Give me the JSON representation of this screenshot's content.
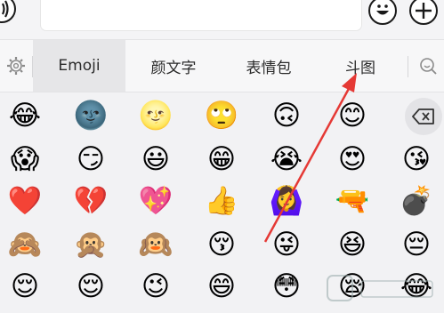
{
  "top_bar": {
    "voice_icon": "speaker-icon",
    "emoji_icon": "smiley-icon",
    "plus_icon": "plus-icon"
  },
  "tabs": [
    {
      "label": "",
      "icon": "gear-icon"
    },
    {
      "label": "Emoji"
    },
    {
      "label": "颜文字"
    },
    {
      "label": "表情包"
    },
    {
      "label": "斗图"
    },
    {
      "label": "",
      "icon": "search-icon"
    }
  ],
  "active_tab": "Emoji",
  "emoji_rows": [
    [
      "😂",
      "🌚",
      "🌝",
      "🙄",
      "🙃",
      "😊"
    ],
    [
      "😱",
      "😏",
      "😃",
      "😁",
      "😭",
      "😍",
      "😘"
    ],
    [
      "❤️",
      "💔",
      "💖",
      "👍",
      "🙆‍♀️",
      "🔫",
      "💣"
    ],
    [
      "🙈",
      "🙊",
      "🙉",
      "😚",
      "😜",
      "😆",
      "😔"
    ],
    [
      "😌",
      "😌",
      "😉",
      "😄",
      "😳",
      "😪",
      "😂"
    ]
  ],
  "delete_key_icon": "backspace-icon",
  "annotation": {
    "color": "#e53935",
    "target": "斗图"
  }
}
